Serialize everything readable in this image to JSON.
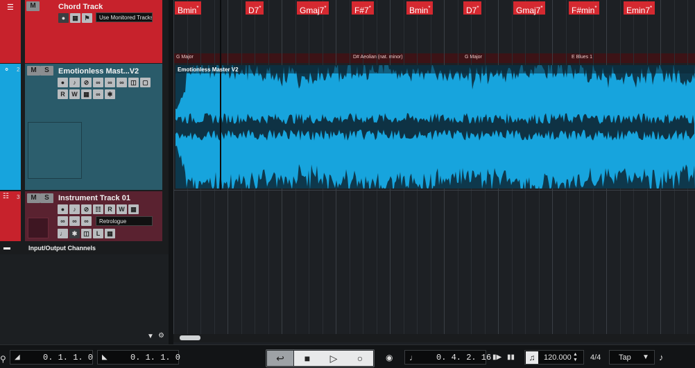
{
  "tracks": {
    "chord": {
      "name": "Chord Track",
      "m_label": "M",
      "monitor_label": "Use Monitored Tracks"
    },
    "audio": {
      "name": "Emotionless Mast...V2",
      "number": "2",
      "m_label": "M",
      "s_label": "S",
      "r_label": "R",
      "w_label": "W"
    },
    "instrument": {
      "name": "Instrument Track 01",
      "number": "3",
      "m_label": "M",
      "s_label": "S",
      "r_label": "R",
      "w_label": "W",
      "instrument": "Retrologue",
      "l_label": "L"
    },
    "io": {
      "name": "Input/Output Channels"
    }
  },
  "chords": [
    {
      "root": "Bmin",
      "ext": "*"
    },
    {
      "root": "D7",
      "ext": "*"
    },
    {
      "root": "Gmaj7",
      "ext": "*"
    },
    {
      "root": "F#7",
      "ext": "*"
    },
    {
      "root": "Bmin",
      "ext": "*"
    },
    {
      "root": "D7",
      "ext": "*"
    },
    {
      "root": "Gmaj7",
      "ext": "*"
    },
    {
      "root": "F#min",
      "ext": "*"
    },
    {
      "root": "Emin7",
      "ext": "*"
    }
  ],
  "scales": [
    "G Major",
    "D# Aeolian (nat. minor)",
    "G Major",
    "E Blues 1"
  ],
  "event": {
    "title": "Emotionless Master V2"
  },
  "transport": {
    "left_locator": "0. 1. 1.   0",
    "right_locator": "0. 1. 1.   0",
    "position": "0. 4. 2. 16",
    "tempo": "120.000",
    "signature": "4/4",
    "tap_label": "Tap"
  },
  "colors": {
    "chord_track": "#c7222c",
    "audio_track": "#17a4dd",
    "audio_panel": "#2a5b6a",
    "instrument_panel": "#5a2230",
    "waveform": "#0d2633",
    "chord_event": "#d52930"
  }
}
